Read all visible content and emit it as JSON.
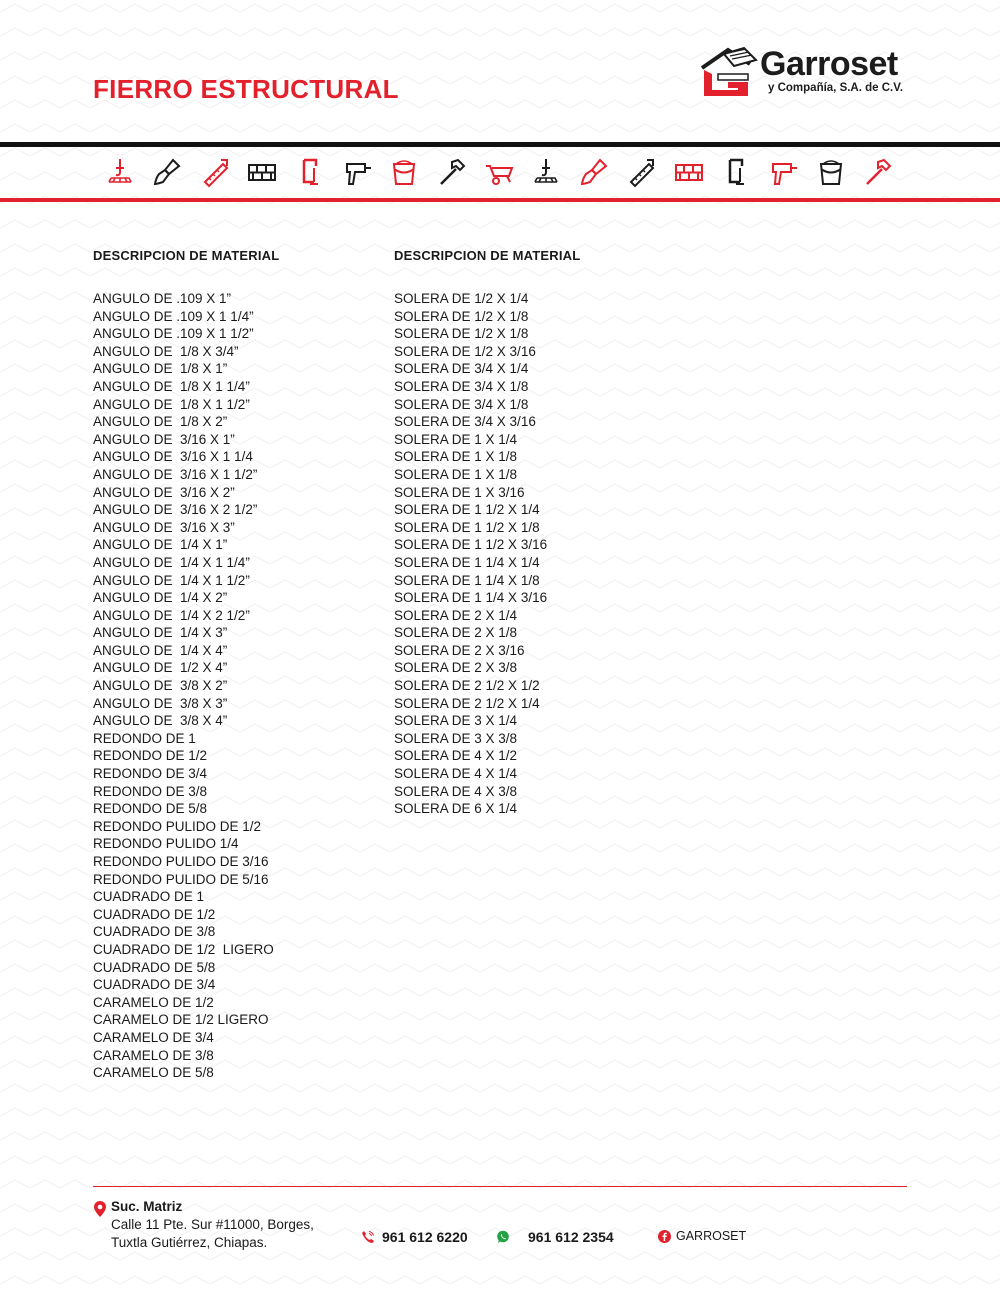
{
  "header": {
    "title": "FIERRO ESTRUCTURAL",
    "brand": "Garroset",
    "brand_sub": "y Compañía, S.A. de C.V."
  },
  "colors": {
    "accent": "#e3212d",
    "rule": "#111111",
    "text": "#1a1a1a"
  },
  "icons": [
    "crane-hook-icon",
    "paint-brush-icon",
    "saw-icon",
    "bricks-icon",
    "clamp-icon",
    "drill-icon",
    "paint-bucket-icon",
    "hammer-icon",
    "wheelbarrow-icon",
    "crane-hook-icon",
    "paint-brush-icon",
    "saw-icon",
    "bricks-icon",
    "clamp-icon",
    "drill-icon",
    "paint-bucket-icon",
    "hammer-icon"
  ],
  "left": {
    "heading": "DESCRIPCION DE MATERIAL",
    "items": [
      "ANGULO DE .109 X 1”",
      "ANGULO DE .109 X 1 1/4”",
      "ANGULO DE .109 X 1 1/2”",
      "ANGULO DE  1/8 X 3/4”",
      "ANGULO DE  1/8 X 1”",
      "ANGULO DE  1/8 X 1 1/4”",
      "ANGULO DE  1/8 X 1 1/2”",
      "ANGULO DE  1/8 X 2”",
      "ANGULO DE  3/16 X 1”",
      "ANGULO DE  3/16 X 1 1/4",
      "ANGULO DE  3/16 X 1 1/2”",
      "ANGULO DE  3/16 X 2”",
      "ANGULO DE  3/16 X 2 1/2”",
      "ANGULO DE  3/16 X 3”",
      "ANGULO DE  1/4 X 1”",
      "ANGULO DE  1/4 X 1 1/4”",
      "ANGULO DE  1/4 X 1 1/2”",
      "ANGULO DE  1/4 X 2”",
      "ANGULO DE  1/4 X 2 1/2”",
      "ANGULO DE  1/4 X 3”",
      "ANGULO DE  1/4 X 4”",
      "ANGULO DE  1/2 X 4”",
      "ANGULO DE  3/8 X 2”",
      "ANGULO DE  3/8 X 3”",
      "ANGULO DE  3/8 X 4”",
      "REDONDO DE 1",
      "REDONDO DE 1/2",
      "REDONDO DE 3/4",
      "REDONDO DE 3/8",
      "REDONDO DE 5/8",
      "REDONDO PULIDO DE 1/2",
      "REDONDO PULIDO 1/4",
      "REDONDO PULIDO DE 3/16",
      "REDONDO PULIDO DE 5/16",
      "CUADRADO DE 1",
      "CUADRADO DE 1/2",
      "CUADRADO DE 3/8",
      "CUADRADO DE 1/2  LIGERO",
      "CUADRADO DE 5/8",
      "CUADRADO DE 3/4",
      "CARAMELO DE 1/2",
      "CARAMELO DE 1/2 LIGERO",
      "CARAMELO DE 3/4",
      "CARAMELO DE 3/8",
      "CARAMELO DE 5/8"
    ]
  },
  "right": {
    "heading": "DESCRIPCION DE MATERIAL",
    "items": [
      "SOLERA DE 1/2 X 1/4",
      "SOLERA DE 1/2 X 1/8",
      "SOLERA DE 1/2 X 1/8",
      "SOLERA DE 1/2 X 3/16",
      "SOLERA DE 3/4 X 1/4",
      "SOLERA DE 3/4 X 1/8",
      "SOLERA DE 3/4 X 1/8",
      "SOLERA DE 3/4 X 3/16",
      "SOLERA DE 1 X 1/4",
      "SOLERA DE 1 X 1/8",
      "SOLERA DE 1 X 1/8",
      "SOLERA DE 1 X 3/16",
      "SOLERA DE 1 1/2 X 1/4",
      "SOLERA DE 1 1/2 X 1/8",
      "SOLERA DE 1 1/2 X 3/16",
      "SOLERA DE 1 1/4 X 1/4",
      "SOLERA DE 1 1/4 X 1/8",
      "SOLERA DE 1 1/4 X 3/16",
      "SOLERA DE 2 X 1/4",
      "SOLERA DE 2 X 1/8",
      "SOLERA DE 2 X 3/16",
      "SOLERA DE 2 X 3/8",
      "SOLERA DE 2 1/2 X 1/2",
      "SOLERA DE 2 1/2 X 1/4",
      "SOLERA DE 3 X 1/4",
      "SOLERA DE 3 X 3/8",
      "SOLERA DE 4 X 1/2",
      "SOLERA DE 4 X 1/4",
      "SOLERA DE 4 X 3/8",
      "SOLERA DE 6 X 1/4"
    ]
  },
  "footer": {
    "branch_label": "Suc. Matriz",
    "address_line1": "Calle 11 Pte. Sur #11000, Borges,",
    "address_line2": "Tuxtla Gutiérrez, Chiapas.",
    "phone": "961 612 6220",
    "whatsapp": "961 612 2354",
    "facebook": "GARROSET"
  }
}
